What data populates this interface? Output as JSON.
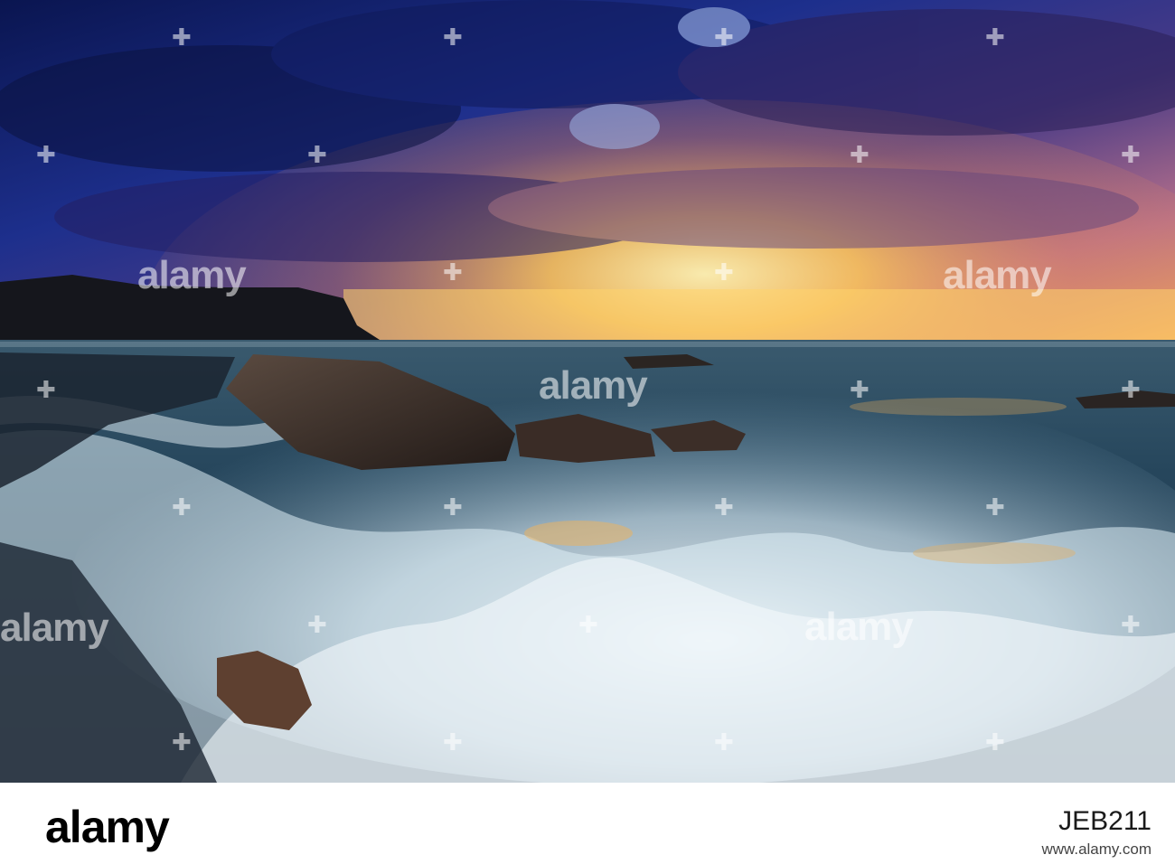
{
  "image": {
    "subject": "seascape",
    "colors": {
      "sky_top": "#0d1b5c",
      "sky_mid": "#3f3a8a",
      "sky_glow": "#f2b64a",
      "horizon": "#ffd36b",
      "headland": "#15161c",
      "sea": "#2a4f66",
      "foam": "#e8f2f8",
      "rock": "#3b2f2a"
    }
  },
  "watermark": {
    "text": "alamy"
  },
  "footer": {
    "logo": "alamy",
    "image_id": "JEB211",
    "site": "www.alamy.com"
  }
}
